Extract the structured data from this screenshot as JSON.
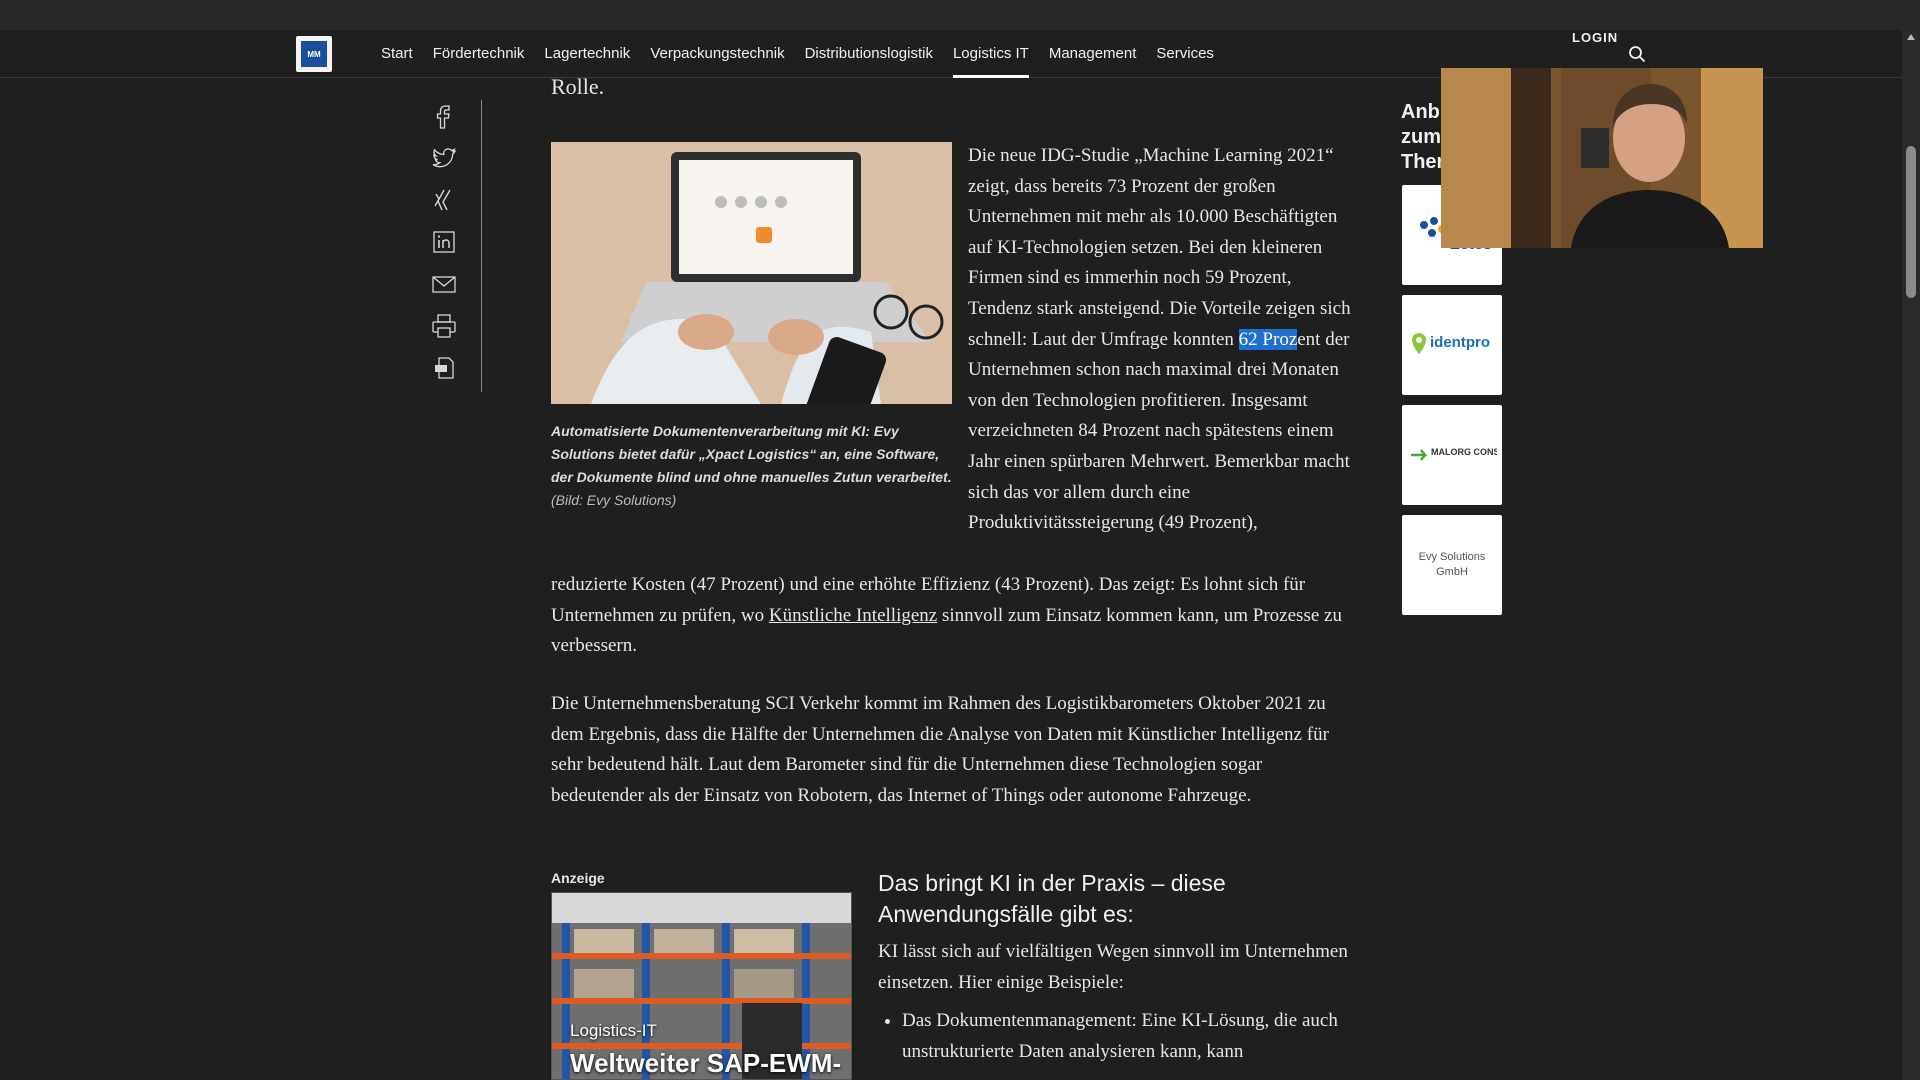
{
  "nav": {
    "logo_text": "MM",
    "items": [
      "Start",
      "Fördertechnik",
      "Lagertechnik",
      "Verpackungstechnik",
      "Distributionslogistik",
      "Logistics IT",
      "Management",
      "Services"
    ],
    "active": "Logistics IT",
    "login": "LOGIN"
  },
  "share": {
    "icons": [
      "facebook-icon",
      "twitter-icon",
      "xing-icon",
      "linkedin-icon",
      "email-icon",
      "print-icon",
      "pdf-icon"
    ]
  },
  "article": {
    "prev_line": "Rolle.",
    "figure": {
      "caption": "Automatisierte Dokumentenverarbeitung mit KI: Evy Solutions bietet dafür „Xpact Logistics“ an, eine Software, der Dokumente blind und ohne manuelles Zutun verarbeitet.",
      "credit": "(Bild: Evy Solutions)"
    },
    "para1_before_highlight": "Die neue IDG-Studie „Machine Learning 2021“ zeigt, dass bereits 73 Prozent der großen Unternehmen mit mehr als 10.000 Beschäftigten auf KI-Technologien setzen. Bei den kleineren Firmen sind es immerhin noch 59 Prozent, Tendenz stark ansteigend. Die Vorteile zeigen sich schnell: Laut der Umfrage konnten ",
    "para1_highlight": "62 Proz",
    "para1_after_highlight": "ent der Unternehmen schon nach maximal drei Monaten von den Technologien profitieren. Insgesamt verzeichneten 84 Prozent nach spätestens einem Jahr einen spürbaren Mehrwert. Bemerkbar macht sich das vor allem durch eine Produktivitätssteigerung (49 Prozent),",
    "para1_full_before_link": "reduzierte Kosten (47 Prozent) und eine erhöhte Effizienz (43 Prozent). Das zeigt: Es lohnt sich für Unternehmen zu prüfen, wo ",
    "para1_link": "Künstliche Intelligenz",
    "para1_full_after_link": " sinnvoll zum Einsatz kommen kann, um Prozesse zu verbessern.",
    "para2": "Die Unternehmensberatung SCI Verkehr kommt im Rahmen des Logistikbarometers Oktober 2021 zu dem Ergebnis, dass die Hälfte der Unternehmen die Analyse von Daten mit Künstlicher Intelligenz für sehr bedeutend hält. Laut dem Barometer sind für die Unternehmen diese Technologien sogar bedeutender als der Einsatz von Robotern, das Internet of Things oder autonome Fahrzeuge.",
    "ad": {
      "label": "Anzeige",
      "kicker": "Logistics-IT",
      "title": "Weltweiter SAP-EWM-"
    },
    "h2": "Das bringt KI in der Praxis – diese Anwendungsfälle gibt es:",
    "para3": "KI lässt sich auf vielfältigen Wegen sinnvoll im Unternehmen einsetzen. Hier einige Beispiele:",
    "list": [
      "Das Dokumentenmanagement: Eine KI-Lösung, die auch unstrukturierte Daten analysieren kann, kann"
    ]
  },
  "sidebar": {
    "title": "Anbieter zum Thema",
    "vendors": [
      "Zetes",
      "identpro",
      "MALORG CONSULTING",
      "Evy Solutions GmbH"
    ]
  },
  "colors": {
    "background": "#1f1f1f",
    "highlight": "#1f6fd1",
    "accent": "#1b4f9c"
  }
}
